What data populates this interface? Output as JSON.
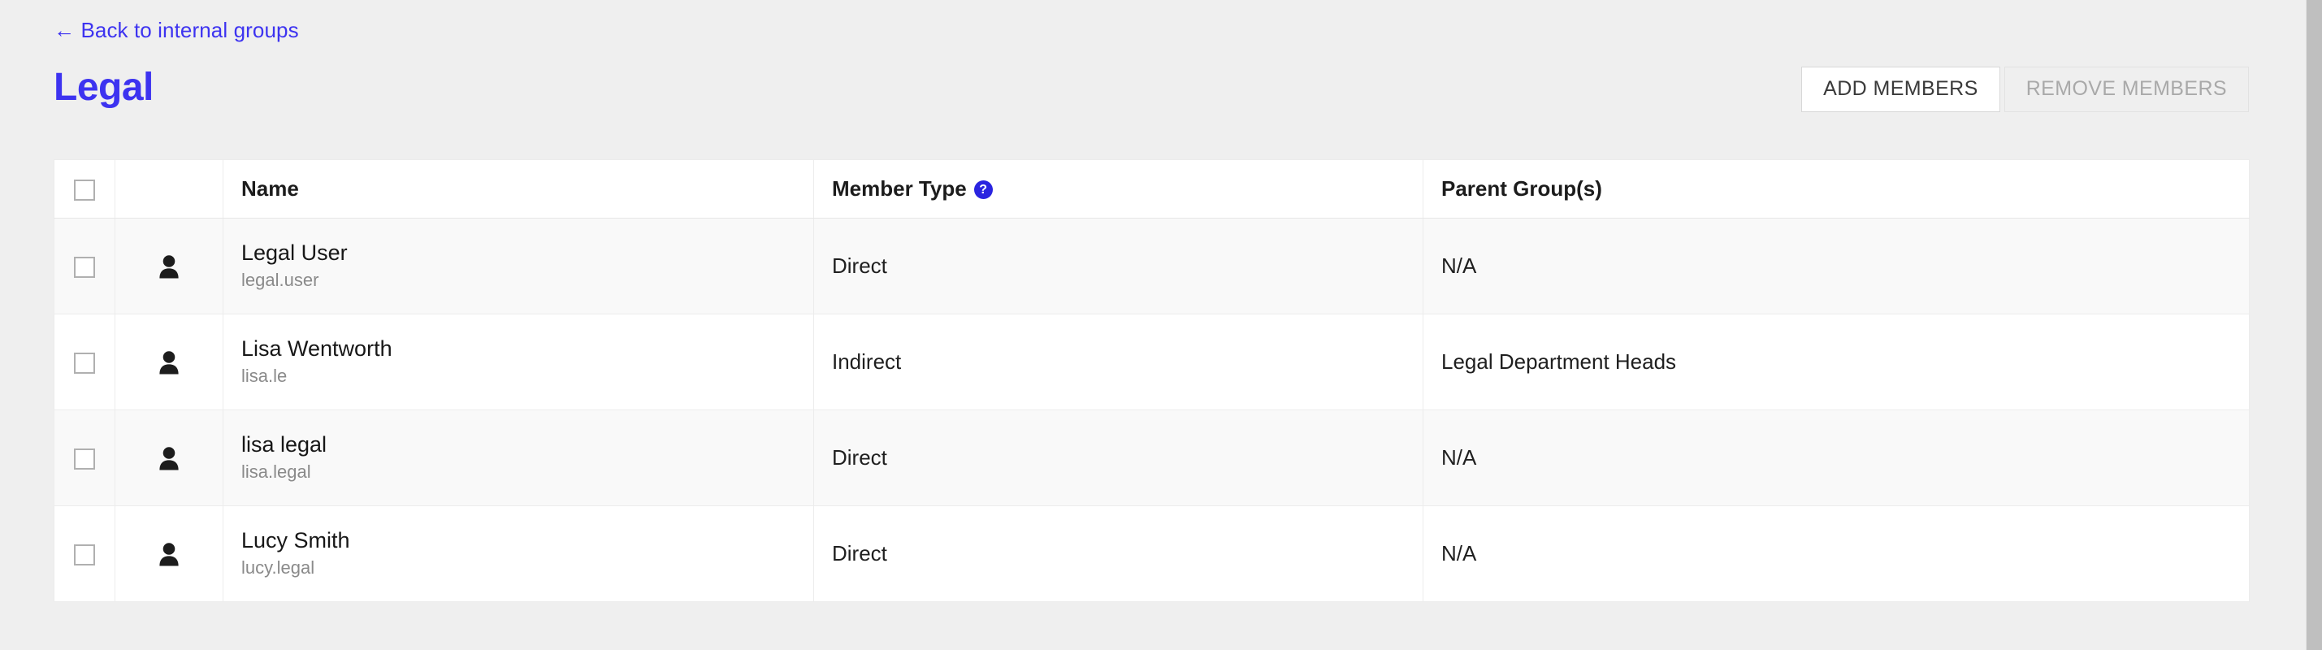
{
  "header": {
    "back_link": "Back to internal groups",
    "back_arrow": "←",
    "title": "Legal"
  },
  "toolbar": {
    "add_members_label": "ADD MEMBERS",
    "remove_members_label": "REMOVE MEMBERS"
  },
  "table": {
    "columns": {
      "name": "Name",
      "member_type": "Member Type",
      "parent_groups": "Parent Group(s)"
    },
    "member_type_help_glyph": "?",
    "rows": [
      {
        "name": "Legal User",
        "username": "legal.user",
        "member_type": "Direct",
        "parent_groups": "N/A"
      },
      {
        "name": "Lisa Wentworth",
        "username": "lisa.le",
        "member_type": "Indirect",
        "parent_groups": "Legal Department Heads"
      },
      {
        "name": "lisa legal",
        "username": "lisa.legal",
        "member_type": "Direct",
        "parent_groups": "N/A"
      },
      {
        "name": "Lucy Smith",
        "username": "lucy.legal",
        "member_type": "Direct",
        "parent_groups": "N/A"
      }
    ]
  },
  "colors": {
    "accent_blue": "#3d33f0",
    "help_icon_blue": "#2a24e0",
    "page_background": "#efefef",
    "row_alt_background": "#f9f9f9"
  }
}
